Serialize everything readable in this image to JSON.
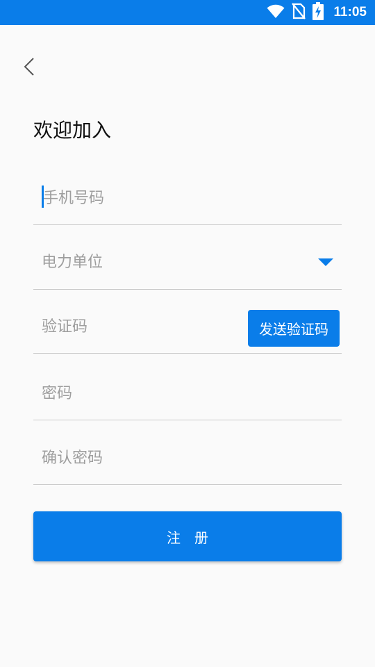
{
  "status_bar": {
    "time": "11:05",
    "icons": [
      "wifi-icon",
      "no-sim-icon",
      "battery-charging-icon"
    ],
    "color": "#0a7de9"
  },
  "header": {
    "back_icon": "chevron-left-icon",
    "title": "欢迎加入"
  },
  "form": {
    "phone": {
      "placeholder": "手机号码",
      "value": ""
    },
    "unit": {
      "placeholder": "电力单位",
      "icon": "dropdown-triangle-icon"
    },
    "code": {
      "placeholder": "验证码",
      "value": ""
    },
    "send_code_label": "发送验证码",
    "password": {
      "placeholder": "密码",
      "value": ""
    },
    "confirm_password": {
      "placeholder": "确认密码",
      "value": ""
    }
  },
  "register_label": "注　册",
  "colors": {
    "accent": "#0a7de9",
    "background": "#fafafa",
    "divider": "#c9c9c9",
    "placeholder": "#9e9e9e"
  }
}
